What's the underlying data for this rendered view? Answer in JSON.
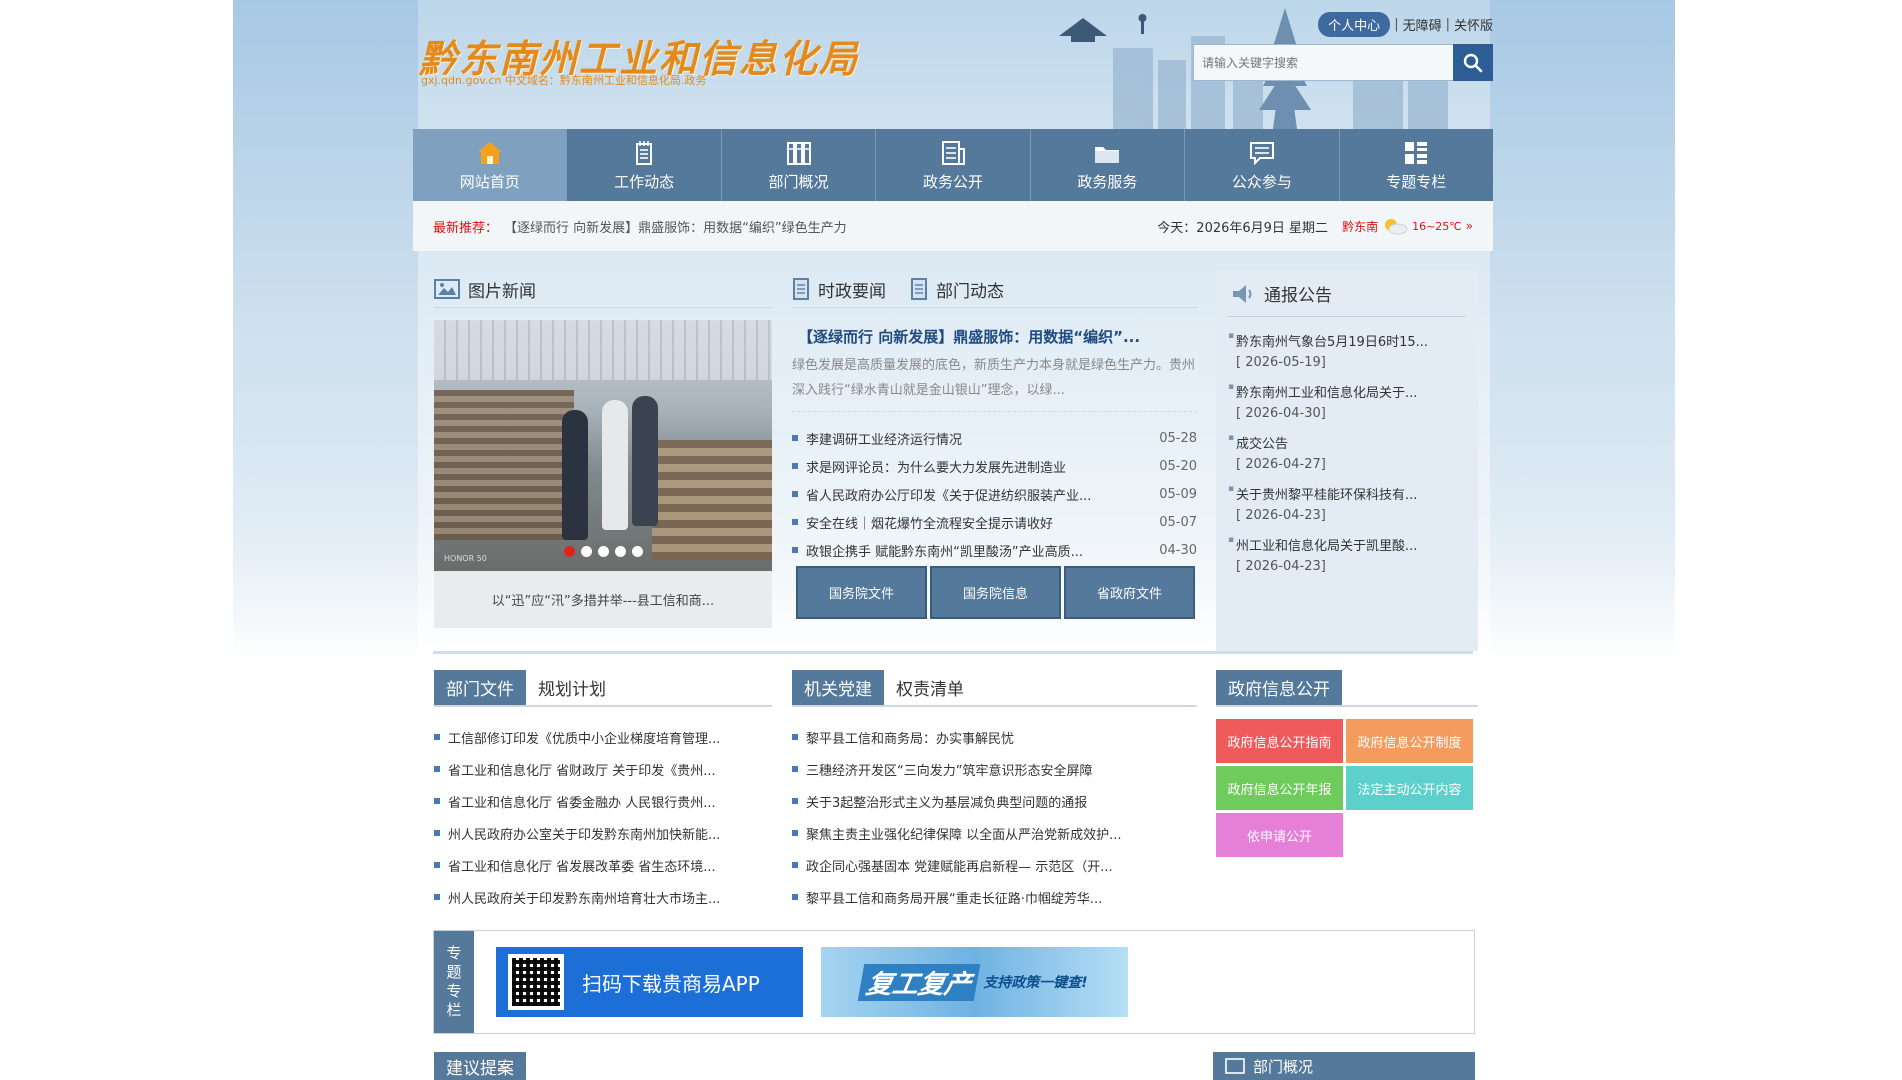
{
  "header": {
    "site_title": "黔东南州工业和信息化局",
    "domain_line": "gxj.qdn.gov.cn  中文域名：黔东南州工业和信息化局.政务",
    "top_links": {
      "personal_center": "个人中心",
      "accessible": "无障碍",
      "care": "关怀版",
      "sep": "|"
    },
    "search_placeholder": "请输入关键字搜索"
  },
  "nav": [
    {
      "label": "网站首页",
      "icon": "home-icon"
    },
    {
      "label": "工作动态",
      "icon": "notepad-icon"
    },
    {
      "label": "部门概况",
      "icon": "books-icon"
    },
    {
      "label": "政务公开",
      "icon": "document-icon"
    },
    {
      "label": "政务服务",
      "icon": "folder-icon"
    },
    {
      "label": "公众参与",
      "icon": "comment-icon"
    },
    {
      "label": "专题专栏",
      "icon": "grid-icon"
    }
  ],
  "ticker": {
    "label": "最新推荐：",
    "news": "【逐绿而行 向新发展】鼎盛服饰：用数据“编织”绿色生产力",
    "date": "今天：2026年6月9日 星期二",
    "city": "黔东南",
    "temp": "16~25℃",
    "more": "»"
  },
  "picture_news": {
    "title": "图片新闻",
    "caption": "以“迅”应“汛”多措并举---县工信和商...",
    "watermark": "HONOR 50",
    "slides": 5,
    "active_slide": 1
  },
  "politics": {
    "tabs": [
      "时政要闻",
      "部门动态"
    ],
    "headline": "【逐绿而行 向新发展】鼎盛服饰：用数据“编织”...",
    "summary": "绿色发展是高质量发展的底色，新质生产力本身就是绿色生产力。贵州深入践行“绿水青山就是金山银山”理念，以绿...",
    "items": [
      {
        "title": "李建调研工业经济运行情况",
        "date": "05-28"
      },
      {
        "title": "求是网评论员：为什么要大力发展先进制造业",
        "date": "05-20"
      },
      {
        "title": "省人民政府办公厅印发《关于促进纺织服装产业...",
        "date": "05-09"
      },
      {
        "title": "安全在线｜烟花爆竹全流程安全提示请收好",
        "date": "05-07"
      },
      {
        "title": "政银企携手 赋能黔东南州“凯里酸汤”产业高质...",
        "date": "04-30"
      }
    ],
    "buttons": [
      "国务院文件",
      "国务院信息",
      "省政府文件"
    ]
  },
  "notice": {
    "title": "通报公告",
    "items": [
      {
        "title": "黔东南州气象台5月19日6时15...",
        "date": "[ 2026-05-19]"
      },
      {
        "title": "黔东南州工业和信息化局关于...",
        "date": "[ 2026-04-30]"
      },
      {
        "title": "成交公告",
        "date": "[ 2026-04-27]"
      },
      {
        "title": "关于贵州黎平桂能环保科技有...",
        "date": "[ 2026-04-23]"
      },
      {
        "title": "州工业和信息化局关于凯里酸...",
        "date": "[ 2026-04-23]"
      }
    ]
  },
  "dept_docs": {
    "tabs": [
      "部门文件",
      "规划计划"
    ],
    "items": [
      "工信部修订印发《优质中小企业梯度培育管理...",
      "省工业和信息化厅 省财政厅 关于印发《贵州...",
      "省工业和信息化厅 省委金融办 人民银行贵州...",
      "州人民政府办公室关于印发黔东南州加快新能...",
      "省工业和信息化厅 省发展改革委 省生态环境...",
      "州人民政府关于印发黔东南州培育壮大市场主..."
    ]
  },
  "party": {
    "tabs": [
      "机关党建",
      "权责清单"
    ],
    "items": [
      "黎平县工信和商务局：办实事解民忧",
      "三穗经济开发区“三向发力”筑牢意识形态安全屏障",
      "关于3起整治形式主义为基层减负典型问题的通报",
      "聚焦主责主业强化纪律保障 以全面从严治党新成效护...",
      "政企同心强基固本 党建赋能再启新程— 示范区（开...",
      "黎平县工信和商务局开展“重走长征路·巾帼绽芳华..."
    ]
  },
  "gov_info": {
    "title": "政府信息公开",
    "cells": [
      {
        "label": "政府信息公开指南",
        "color": "#ef5a5a"
      },
      {
        "label": "政府信息公开制度",
        "color": "#f39c5e"
      },
      {
        "label": "政府信息公开年报",
        "color": "#6fcb5b"
      },
      {
        "label": "法定主动公开内容",
        "color": "#5dd0cc"
      },
      {
        "label": "依申请公开",
        "color": "#e57fd8"
      }
    ]
  },
  "special": {
    "label_chars": [
      "专",
      "题",
      "专",
      "栏"
    ],
    "app_banner": "扫码下载贵商易APP",
    "resume_banner_main": "复工复产",
    "resume_banner_sub": "支持政策一键查!"
  },
  "bottom": {
    "left_tab": "建议提案",
    "right_title": "部门概况"
  },
  "colors": {
    "nav_bg": "#54799b",
    "nav_active": "#7fa0bf",
    "title_blue": "#1f4b80",
    "accent_red": "#e2231a",
    "logo_orange": "#e48a1c"
  }
}
